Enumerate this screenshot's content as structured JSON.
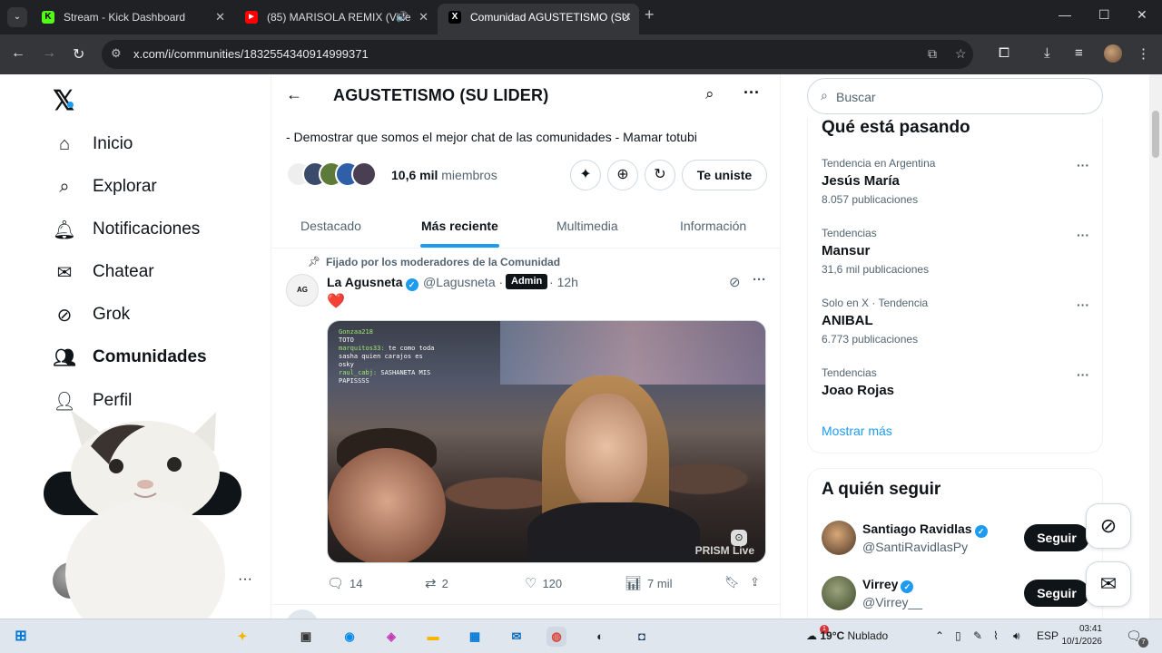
{
  "browser": {
    "tabs": [
      {
        "title": "Stream - Kick Dashboard",
        "favicon": "K",
        "favicon_color": "#53fc18"
      },
      {
        "title": "(85) MARISOLA REMIX (Vide",
        "favicon": "▶",
        "favicon_color": "#ff0000"
      },
      {
        "title": "Comunidad AGUSTETISMO (SU",
        "favicon": "X",
        "favicon_color": "#000000"
      }
    ],
    "url": "x.com/i/communities/1832554340914999371"
  },
  "sidebar": {
    "items": [
      {
        "label": "Inicio",
        "icon": "home-icon"
      },
      {
        "label": "Explorar",
        "icon": "search-icon"
      },
      {
        "label": "Notificaciones",
        "icon": "bell-icon"
      },
      {
        "label": "Chatear",
        "icon": "mail-icon"
      },
      {
        "label": "Grok",
        "icon": "grok-icon"
      },
      {
        "label": "Comunidades",
        "icon": "people-icon"
      },
      {
        "label": "Perfil",
        "icon": "person-icon"
      }
    ]
  },
  "community": {
    "title": "AGUSTETISMO (SU LIDER)",
    "description": "- Demostrar que somos el mejor chat de las comunidades - Mamar totubi",
    "members_count": "10,6 mil",
    "members_label": "miembros",
    "joined_label": "Te uniste",
    "tabs": [
      "Destacado",
      "Más reciente",
      "Multimedia",
      "Información"
    ]
  },
  "post": {
    "pinned_label": "Fijado por los moderadores de la Comunidad",
    "author_name": "La Agusneta",
    "author_handle": "@Lagusneta",
    "badge": "Admin",
    "separator": "·",
    "time": "12h",
    "text": "❤️",
    "chat_lines": [
      {
        "user": "Gonzaa218",
        "msg": ""
      },
      {
        "user": "TOTO",
        "msg": ""
      },
      {
        "user": "marquitos33:",
        "msg": "te como toda sasha quien carajos es osky"
      },
      {
        "user": "raul_cabj:",
        "msg": "SASHANETA MIS PAPISSSS"
      }
    ],
    "watermark": "PRISM Live",
    "replies": "14",
    "reposts": "2",
    "likes": "120",
    "views": "7 mil"
  },
  "right": {
    "search_placeholder": "Buscar",
    "trends_title": "Qué está pasando",
    "trends": [
      {
        "context": "Tendencia en Argentina",
        "name": "Jesús María",
        "count": "8.057 publicaciones"
      },
      {
        "context": "Tendencias",
        "name": "Mansur",
        "count": "31,6 mil publicaciones"
      },
      {
        "context": "Solo en X · Tendencia",
        "name": "ANIBAL",
        "count": "6.773 publicaciones"
      },
      {
        "context": "Tendencias",
        "name": "Joao Rojas",
        "count": ""
      }
    ],
    "show_more": "Mostrar más",
    "who_title": "A quién seguir",
    "who": [
      {
        "name": "Santiago Ravidlas",
        "handle": "@SantiRavidlasPy",
        "button": "Seguir"
      },
      {
        "name": "Virrey",
        "handle": "@Virrey__",
        "button": "Seguir"
      }
    ]
  },
  "taskbar": {
    "weather_temp": "19°C",
    "weather_text": "Nublado",
    "lang": "ESP",
    "time": "03:41",
    "date": "10/1/2026",
    "notif_count": "7",
    "weather_badge": "1"
  }
}
